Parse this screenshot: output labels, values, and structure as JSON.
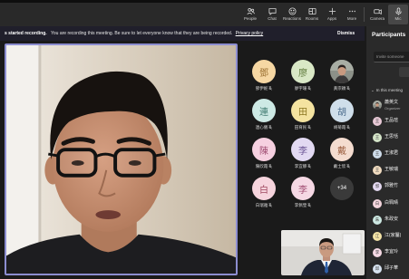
{
  "toolbar": {
    "items": [
      {
        "label": "People",
        "icon": "people-icon"
      },
      {
        "label": "Chat",
        "icon": "chat-icon"
      },
      {
        "label": "Reactions",
        "icon": "reactions-icon"
      },
      {
        "label": "Rooms",
        "icon": "rooms-icon"
      },
      {
        "label": "Apps",
        "icon": "apps-icon"
      },
      {
        "label": "More",
        "icon": "more-icon"
      }
    ],
    "camera": {
      "label": "Camera",
      "icon": "camera-icon"
    },
    "mic": {
      "label": "Mic",
      "icon": "mic-icon"
    }
  },
  "banner": {
    "title": "s started recording.",
    "message": "You are recording this meeting. Be sure to let everyone know that they are being recorded.",
    "link": "Privacy policy",
    "dismiss": "Dismiss"
  },
  "stage": {
    "gallery": {
      "tiles": [
        {
          "initial": "鄧",
          "name": "鄧伊妮",
          "bg": "#f6d7a3",
          "fg": "#9b7032",
          "muted": true
        },
        {
          "initial": "廖",
          "name": "廖宇珊",
          "bg": "#d9e8c6",
          "fg": "#5f7a3c",
          "muted": true
        },
        {
          "photo": true,
          "name": "黃宗穎",
          "muted": true
        },
        {
          "initial": "連",
          "name": "連心儀",
          "bg": "#cde9e4",
          "fg": "#3f7a70",
          "muted": true
        },
        {
          "initial": "田",
          "name": "田育民",
          "bg": "#f4e3a0",
          "fg": "#8a7520",
          "muted": true
        },
        {
          "initial": "胡",
          "name": "胡菊霞",
          "bg": "#cfdeea",
          "fg": "#48698a",
          "muted": true
        },
        {
          "initial": "陳",
          "name": "陳欣霞",
          "bg": "#f6d0e0",
          "fg": "#a04d72",
          "muted": true
        },
        {
          "initial": "李",
          "name": "李宜靜",
          "bg": "#e2d9f2",
          "fg": "#6a5494",
          "muted": true
        },
        {
          "initial": "戴",
          "name": "戴士欣",
          "bg": "#f4dccf",
          "fg": "#9b5e3f",
          "muted": true
        },
        {
          "initial": "白",
          "name": "白瑞雅",
          "bg": "#f6d4dd",
          "fg": "#a04a61",
          "muted": true
        },
        {
          "initial": "李",
          "name": "李佩瑩",
          "bg": "#f5d8e4",
          "fg": "#a04d72",
          "muted": true
        }
      ],
      "overflow": "+34"
    }
  },
  "participants": {
    "title": "Participants",
    "invite_placeholder": "Invite someone",
    "section_label": "In this meeting",
    "people": [
      {
        "name": "蕭英文",
        "role": "Organizer",
        "photo": true
      },
      {
        "name": "王品瑄",
        "initial": "王",
        "bg": "#e8c9d6"
      },
      {
        "name": "王思恬",
        "initial": "王",
        "bg": "#d4e4c8"
      },
      {
        "name": "王淑君",
        "initial": "王",
        "bg": "#cfdcea"
      },
      {
        "name": "王敏瑞",
        "initial": "王",
        "bg": "#f1dcc0"
      },
      {
        "name": "郭雅竹",
        "initial": "郭",
        "bg": "#e3d8f0"
      },
      {
        "name": "白珮晴",
        "initial": "白",
        "bg": "#f3d4dc"
      },
      {
        "name": "朱政安",
        "initial": "朱",
        "bg": "#cde8e2"
      },
      {
        "name": "江(家屬)",
        "initial": "江",
        "bg": "#f4e3a6"
      },
      {
        "name": "李宜玲",
        "initial": "李",
        "bg": "#f5d8e4"
      },
      {
        "name": "邱子華",
        "initial": "邱",
        "bg": "#d6e2ef"
      }
    ]
  },
  "colors": {
    "accent": "#8c8dd0",
    "toolbar_bg": "#292929",
    "banner_bg": "#201f2b",
    "stage_bg": "#1a1a1a",
    "panel_bg": "#2a2a2a"
  }
}
